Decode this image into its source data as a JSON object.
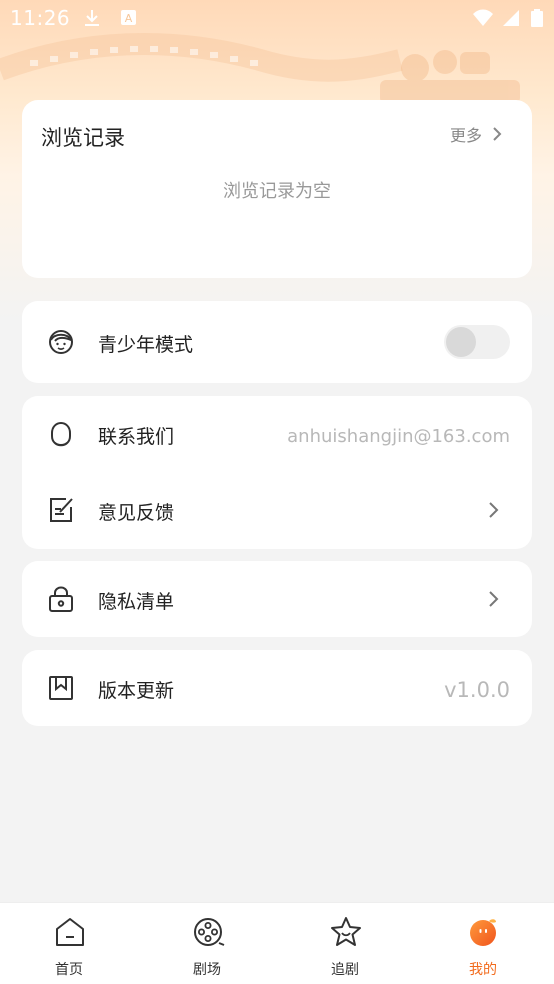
{
  "status_bar": {
    "time": "11:26",
    "left_icons": [
      "download-icon",
      "keyboard-a-icon"
    ],
    "right_icons": [
      "wifi-icon",
      "signal-icon",
      "battery-icon"
    ]
  },
  "history": {
    "title": "浏览记录",
    "more_label": "更多",
    "empty_text": "浏览记录为空"
  },
  "settings": {
    "youth_mode": {
      "label": "青少年模式",
      "icon": "child-face-icon",
      "enabled": false
    },
    "contact": {
      "label": "联系我们",
      "icon": "headset-icon",
      "value": "anhuishangjin@163.com"
    },
    "feedback": {
      "label": "意见反馈",
      "icon": "edit-note-icon"
    },
    "privacy": {
      "label": "隐私清单",
      "icon": "lock-icon"
    },
    "version": {
      "label": "版本更新",
      "icon": "bookmark-icon",
      "value": "v1.0.0"
    }
  },
  "tabbar": {
    "tabs": [
      {
        "label": "首页",
        "icon": "home-icon",
        "active": false
      },
      {
        "label": "剧场",
        "icon": "film-reel-icon",
        "active": false
      },
      {
        "label": "追剧",
        "icon": "star-icon",
        "active": false
      },
      {
        "label": "我的",
        "icon": "profile-blob-icon",
        "active": true
      }
    ]
  },
  "colors": {
    "accent": "#f26b1d",
    "background": "#f3f3f3",
    "card": "#ffffff",
    "text_primary": "#222222",
    "text_secondary": "#999999"
  }
}
